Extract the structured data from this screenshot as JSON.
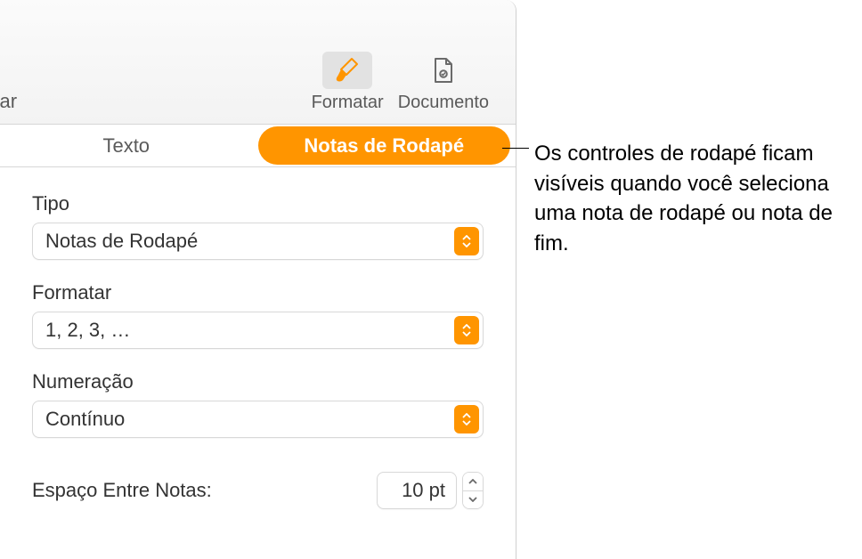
{
  "toolbar": {
    "left_partial": "orar",
    "format": {
      "label": "Formatar"
    },
    "document": {
      "label": "Documento"
    }
  },
  "tabs": {
    "text": "Texto",
    "footnotes": "Notas de Rodapé"
  },
  "fields": {
    "type": {
      "label": "Tipo",
      "value": "Notas de Rodapé"
    },
    "format": {
      "label": "Formatar",
      "value": "1, 2, 3, …"
    },
    "numbering": {
      "label": "Numeração",
      "value": "Contínuo"
    },
    "spacing": {
      "label": "Espaço Entre Notas:",
      "value": "10 pt"
    }
  },
  "callout": {
    "text": "Os controles de rodapé ficam visíveis quando você seleciona uma nota de rodapé ou nota de fim."
  },
  "colors": {
    "accent": "#ff9500"
  }
}
